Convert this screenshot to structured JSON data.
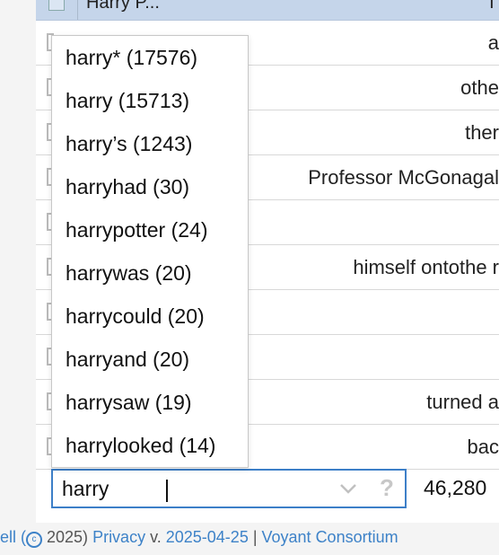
{
  "grid": {
    "header_label": "Harry P...",
    "header_right": "T",
    "rows": [
      {
        "text": "a"
      },
      {
        "text": "othe"
      },
      {
        "text": "ther"
      },
      {
        "text": "Professor McGonagal"
      },
      {
        "text": ""
      },
      {
        "text": "himself ontothe r"
      },
      {
        "text": ""
      },
      {
        "text": ""
      },
      {
        "text": "turned a"
      },
      {
        "text": "bac"
      }
    ]
  },
  "suggestions": [
    {
      "label": "harry* (17576)"
    },
    {
      "label": "harry (15713)"
    },
    {
      "label": "harry’s (1243)"
    },
    {
      "label": "harryhad (30)"
    },
    {
      "label": "harrypotter (24)"
    },
    {
      "label": "harrywas (20)"
    },
    {
      "label": "harrycould (20)"
    },
    {
      "label": "harryand (20)"
    },
    {
      "label": "harrysaw (19)"
    },
    {
      "label": "harrylooked (14)"
    }
  ],
  "search": {
    "value": "harry",
    "help_label": "?"
  },
  "total_count": "46,280",
  "footer": {
    "prefix": "ell (",
    "year_text": " 2025) ",
    "privacy": "Privacy",
    "version_sep": " v. ",
    "version": "2025-04-25",
    "pipe": " | ",
    "consortium": "Voyant Consortium"
  },
  "colors": {
    "accent": "#3d7fc8",
    "header_bg": "#c5d5ea",
    "link": "#3d82c8"
  }
}
